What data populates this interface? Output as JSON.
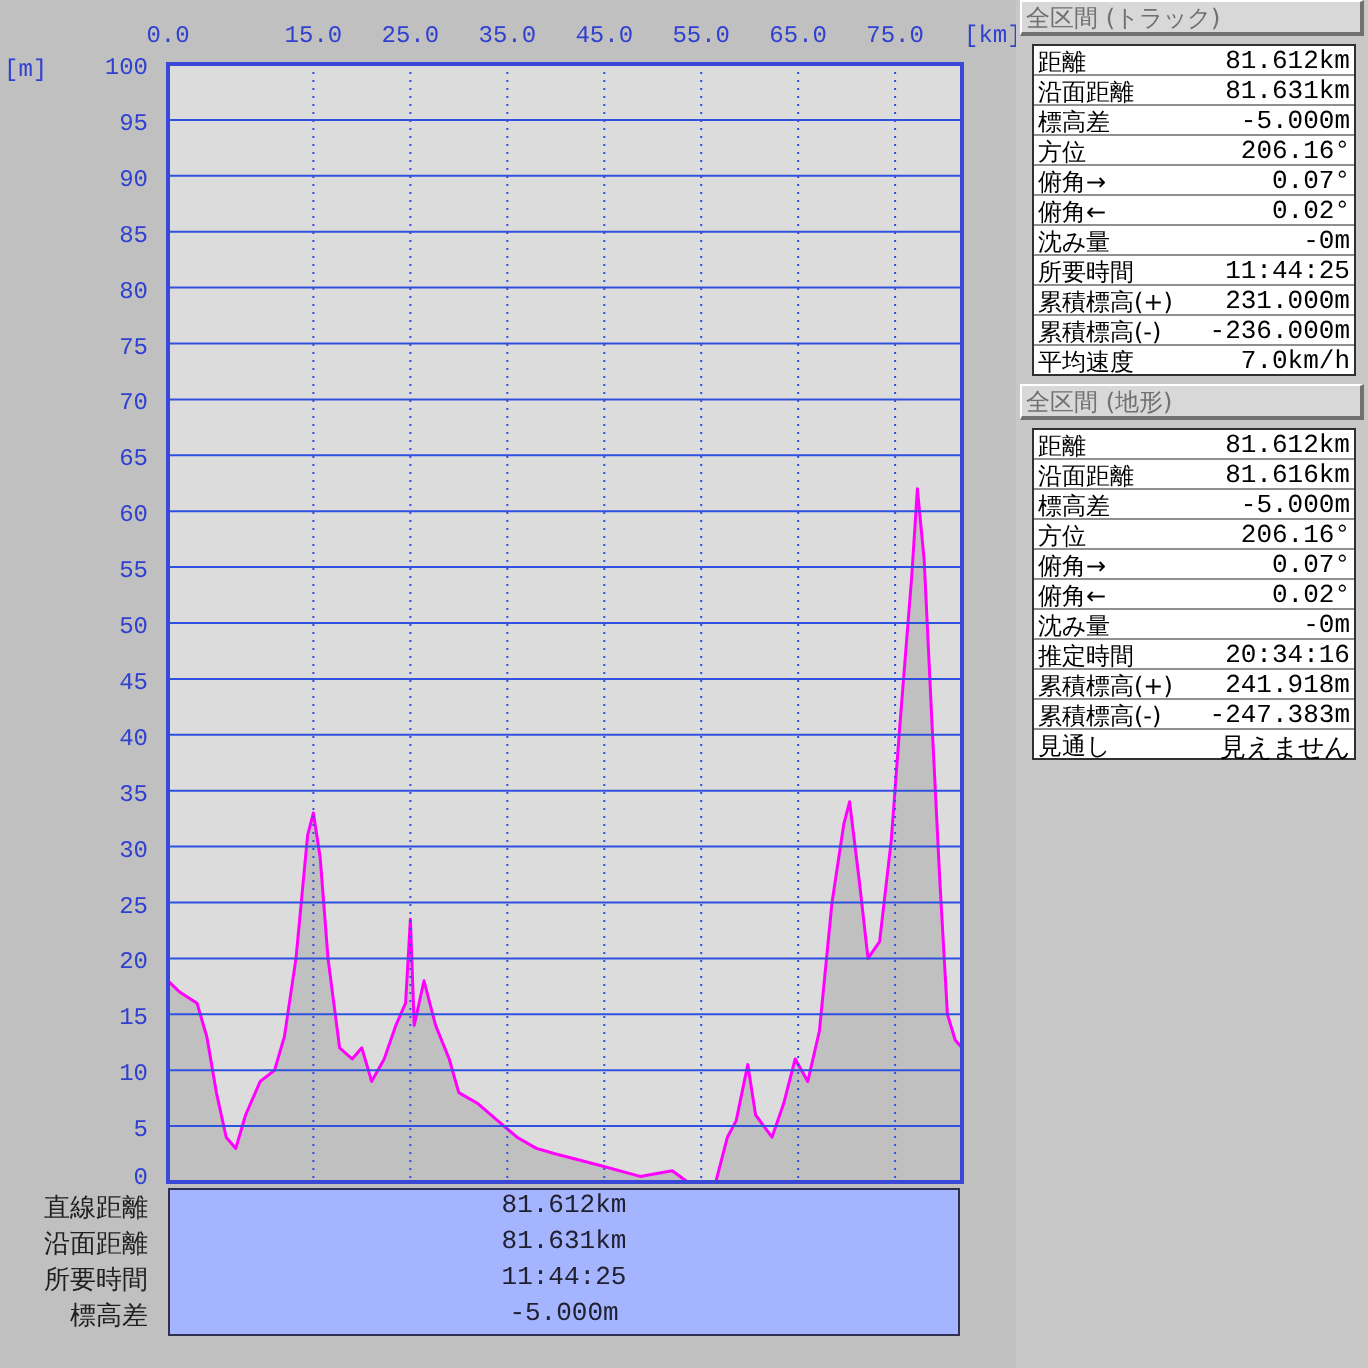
{
  "chart": {
    "chart_data": {
      "type": "area",
      "xlabel": "[km]",
      "ylabel": "[m]",
      "x": [
        0,
        1.2,
        3,
        4,
        5,
        6,
        7,
        8,
        9.5,
        11,
        12,
        13.2,
        14.4,
        15,
        15.7,
        16.5,
        17.7,
        19,
        20,
        21,
        22.3,
        23.5,
        24.5,
        25,
        25.4,
        26.4,
        27.6,
        29,
        30,
        32,
        34,
        36,
        38,
        40,
        44.5,
        48.7,
        52,
        53.6,
        56.5,
        57.7,
        58.6,
        59.8,
        60.6,
        62.3,
        63.5,
        64.7,
        66,
        67.2,
        68.5,
        69.7,
        70.3,
        71.3,
        72.2,
        73.4,
        74.6,
        75.5,
        76.7,
        77.3,
        78,
        78.8,
        79.6,
        80.4,
        81.2,
        81.9
      ],
      "series": [
        {
          "color": "#ff00ff",
          "values": [
            18,
            17,
            16,
            13,
            8,
            4,
            3,
            6,
            9,
            10,
            13,
            20,
            31,
            33,
            29,
            20,
            12,
            11,
            12,
            9,
            11,
            14,
            16,
            23.5,
            14,
            18,
            14,
            11,
            8,
            7,
            5.5,
            4,
            3,
            2.5,
            1.5,
            0.5,
            1,
            0,
            0,
            4,
            5.5,
            10.5,
            6,
            4,
            7,
            11,
            9,
            13.5,
            25,
            32,
            34,
            27,
            20,
            21.5,
            30.5,
            41,
            54,
            62,
            55.6,
            41,
            27,
            15,
            12.7,
            12
          ]
        }
      ],
      "xlim": [
        0,
        81.9
      ],
      "ylim": [
        0,
        100
      ],
      "grid": true,
      "xticks": [
        {
          "value": 0,
          "label": "0.0"
        },
        {
          "value": 15,
          "label": "15.0"
        },
        {
          "value": 25,
          "label": "25.0"
        },
        {
          "value": 35,
          "label": "35.0"
        },
        {
          "value": 45,
          "label": "45.0"
        },
        {
          "value": 55,
          "label": "55.0"
        },
        {
          "value": 65,
          "label": "65.0"
        },
        {
          "value": 75,
          "label": "75.0"
        }
      ],
      "yticks": [
        0,
        5,
        10,
        15,
        20,
        25,
        30,
        35,
        40,
        45,
        50,
        55,
        60,
        65,
        70,
        75,
        80,
        85,
        90,
        95,
        100
      ]
    }
  },
  "summary": [
    {
      "label": "直線距離",
      "value": "81.612km"
    },
    {
      "label": "沿面距離",
      "value": "81.631km"
    },
    {
      "label": "所要時間",
      "value": "11:44:25"
    },
    {
      "label": "標高差",
      "value": "-5.000m"
    }
  ],
  "panels": [
    {
      "title": "全区間 (トラック)",
      "rows": [
        {
          "label": "距離",
          "value": "81.612km"
        },
        {
          "label": "沿面距離",
          "value": "81.631km"
        },
        {
          "label": "標高差",
          "value": "-5.000m"
        },
        {
          "label": "方位",
          "value": "206.16°"
        },
        {
          "label": "俯角→",
          "value": "0.07°"
        },
        {
          "label": "俯角←",
          "value": "0.02°"
        },
        {
          "label": "沈み量",
          "value": "-0m"
        },
        {
          "label": "所要時間",
          "value": "11:44:25"
        },
        {
          "label": "累積標高(+)",
          "value": "231.000m"
        },
        {
          "label": "累積標高(-)",
          "value": "-236.000m"
        },
        {
          "label": "平均速度",
          "value": "7.0km/h"
        }
      ]
    },
    {
      "title": "全区間 (地形)",
      "rows": [
        {
          "label": "距離",
          "value": "81.612km"
        },
        {
          "label": "沿面距離",
          "value": "81.616km"
        },
        {
          "label": "標高差",
          "value": "-5.000m"
        },
        {
          "label": "方位",
          "value": "206.16°"
        },
        {
          "label": "俯角→",
          "value": "0.07°"
        },
        {
          "label": "俯角←",
          "value": "0.02°"
        },
        {
          "label": "沈み量",
          "value": "-0m"
        },
        {
          "label": "推定時間",
          "value": "20:34:16"
        },
        {
          "label": "累積標高(+)",
          "value": "241.918m"
        },
        {
          "label": "累積標高(-)",
          "value": "-247.383m"
        },
        {
          "label": "見通し",
          "value": "見えません"
        }
      ]
    }
  ]
}
